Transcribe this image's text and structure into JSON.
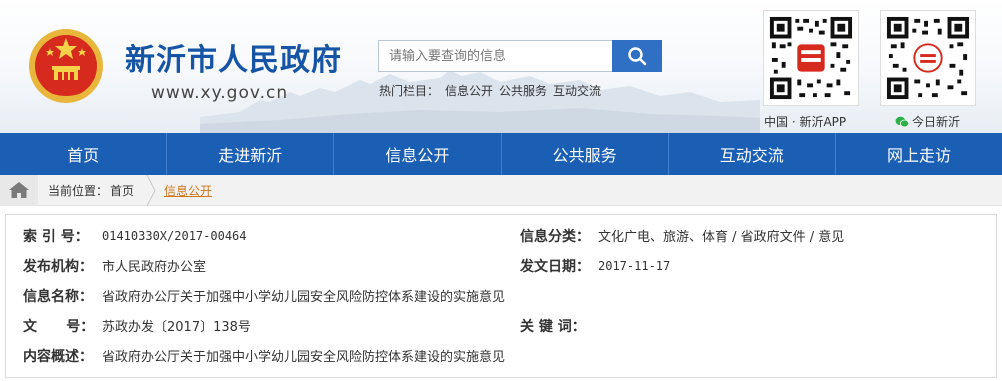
{
  "site": {
    "title": "新沂市人民政府",
    "url": "www.xy.gov.cn"
  },
  "search": {
    "placeholder": "请输入要查询的信息"
  },
  "hot": {
    "label": "热门栏目：",
    "links": [
      "信息公开",
      "公共服务",
      "互动交流"
    ]
  },
  "qr": {
    "app_caption": "中国 · 新沂APP",
    "wechat_caption": "今日新沂"
  },
  "nav": [
    "首页",
    "走进新沂",
    "信息公开",
    "公共服务",
    "互动交流",
    "网上走访"
  ],
  "breadcrumb": {
    "label": "当前位置：",
    "home": "首页",
    "current": "信息公开"
  },
  "info": {
    "index_label": "索 引 号：",
    "index_value": "01410330X/2017-00464",
    "category_label": "信息分类：",
    "category_value": "文化广电、旅游、体育 / 省政府文件 / 意见",
    "publisher_label": "发布机构：",
    "publisher_value": "市人民政府办公室",
    "date_label": "发文日期：",
    "date_value": "2017-11-17",
    "name_label": "信息名称：",
    "name_value": "省政府办公厅关于加强中小学幼儿园安全风险防控体系建设的实施意见",
    "doc_label": "文      号：",
    "doc_value": "苏政办发〔2017〕138号",
    "keyword_label": "关 键 词：",
    "keyword_value": "",
    "summary_label": "内容概述：",
    "summary_value": "省政府办公厅关于加强中小学幼儿园安全风险防控体系建设的实施意见"
  },
  "colors": {
    "brand_blue": "#1a5fb4",
    "title_blue": "#1655a6",
    "crumb_orange": "#d0751a"
  }
}
